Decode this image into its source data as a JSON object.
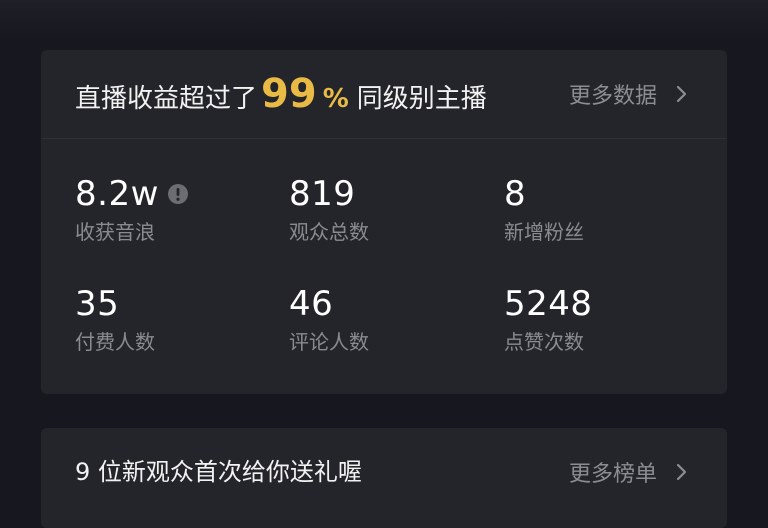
{
  "summary_card": {
    "headline_prefix": "直播收益超过了",
    "headline_percent": "99",
    "headline_percent_sign": "%",
    "headline_suffix": "同级别主播",
    "more_label": "更多数据",
    "stats": [
      {
        "value": "8.2w",
        "label": "收获音浪",
        "has_info_icon": true
      },
      {
        "value": "819",
        "label": "观众总数"
      },
      {
        "value": "8",
        "label": "新增粉丝"
      },
      {
        "value": "35",
        "label": "付费人数"
      },
      {
        "value": "46",
        "label": "评论人数"
      },
      {
        "value": "5248",
        "label": "点赞次数"
      }
    ]
  },
  "gift_card": {
    "title": "9 位新观众首次给你送礼喔",
    "more_label": "更多榜单"
  },
  "icons": {
    "info": "info-icon",
    "chevron": "chevron-right-icon"
  },
  "colors": {
    "background": "#17181f",
    "card": "#24252b",
    "accent": "#e9ba45",
    "secondary_text": "#8a8b91"
  }
}
